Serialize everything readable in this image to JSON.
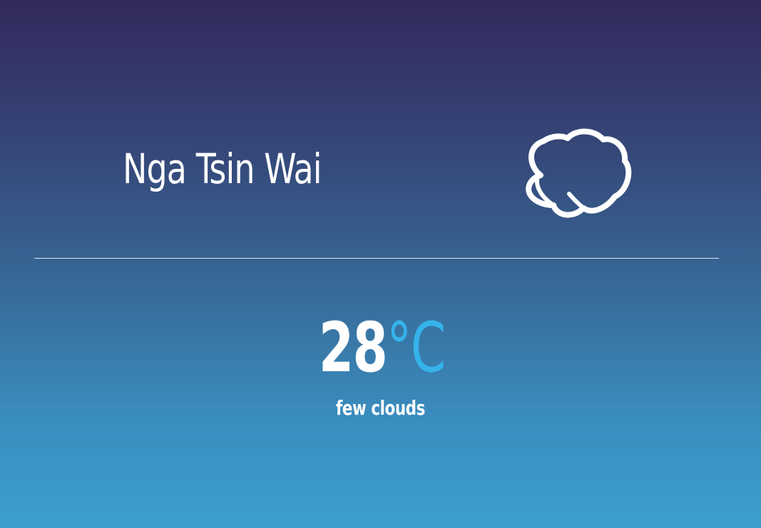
{
  "location": {
    "city": "Nga Tsin Wai"
  },
  "weather": {
    "icon": "cloud-icon",
    "temperature": "28",
    "unit": "°C",
    "description": "few clouds"
  },
  "colors": {
    "background_top": "#33295c",
    "background_bottom": "#3c9fce",
    "text": "#ffffff",
    "unit_accent": "#35b3ea"
  }
}
